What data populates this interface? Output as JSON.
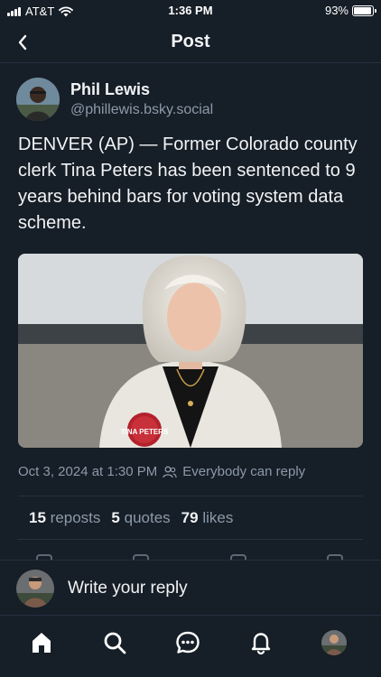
{
  "status_bar": {
    "carrier": "AT&T",
    "time": "1:36 PM",
    "battery_percent": "93%",
    "battery_level": 0.93
  },
  "header": {
    "title": "Post",
    "back_icon": "chevron-left-icon"
  },
  "post": {
    "author_name": "Phil Lewis",
    "author_handle": "@phillewis.bsky.social",
    "text": "DENVER (AP) — Former Colorado county clerk Tina Peters has been sentenced to 9 years behind bars for voting system data scheme.",
    "image_pin_text": "TINA PETERS",
    "timestamp": "Oct 3, 2024 at 1:30 PM",
    "reply_permission": "Everybody can reply",
    "stats": {
      "reposts_count": "15",
      "reposts_label": "reposts",
      "quotes_count": "5",
      "quotes_label": "quotes",
      "likes_count": "79",
      "likes_label": "likes"
    }
  },
  "reply_bar": {
    "placeholder": "Write your reply"
  },
  "tab_bar": {
    "items": [
      "home-icon",
      "search-icon",
      "chat-icon",
      "bell-icon",
      "profile-avatar"
    ]
  },
  "colors": {
    "background": "#161e27",
    "text": "#f1f3f5",
    "muted": "#8c9aaa",
    "divider": "#263140"
  }
}
